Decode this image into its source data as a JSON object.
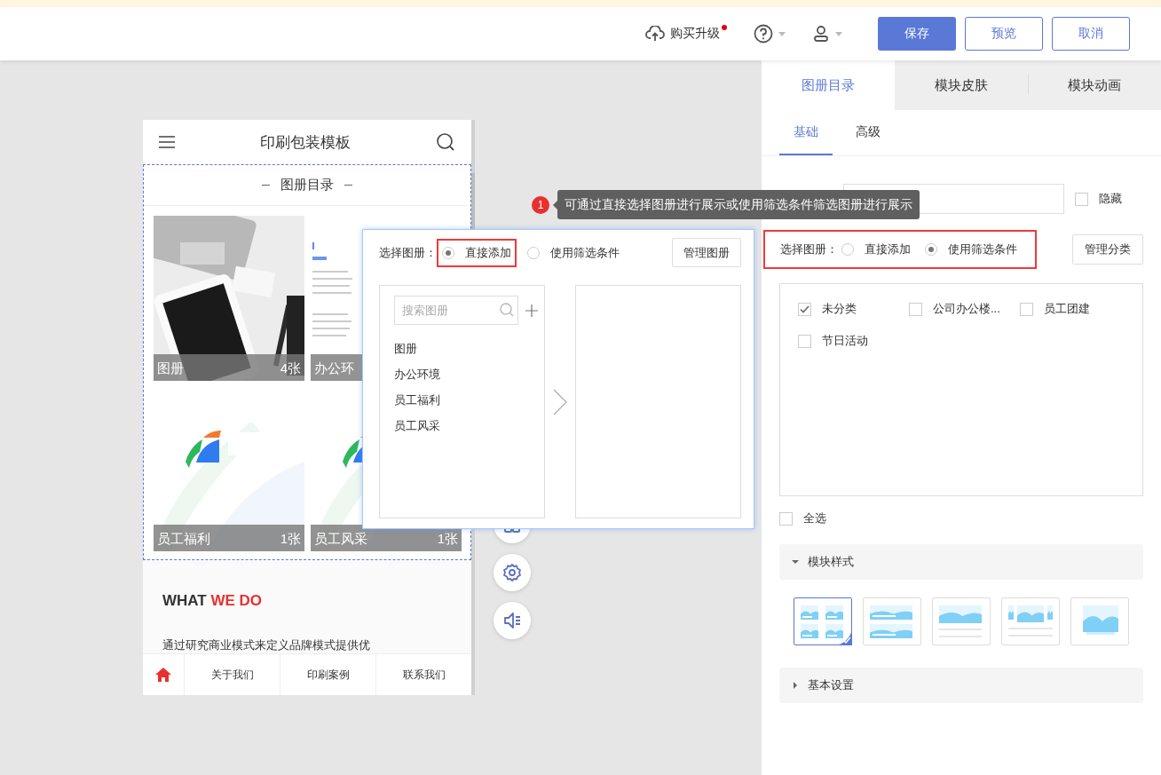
{
  "header": {
    "upgrade": {
      "label": "购买升级",
      "badge": true
    },
    "buttons": [
      {
        "label": "保存",
        "kind": "primary"
      },
      {
        "label": "预览",
        "kind": "outline"
      },
      {
        "label": "取消",
        "kind": "outline"
      }
    ]
  },
  "preview": {
    "title": "印刷包装模板",
    "module_title": "图册目录",
    "albums": [
      {
        "name": "图册",
        "count": "4张"
      },
      {
        "name": "办公环"
      },
      {
        "name": "员工福利",
        "count": "1张"
      },
      {
        "name": "员工风采",
        "count": "1张"
      }
    ],
    "intro": {
      "heading_lead": "WHAT",
      "heading_accent": "WE DO",
      "text": "通过研究商业模式来定义品牌模式提供优"
    },
    "nav": [
      "关于我们",
      "印刷案例",
      "联系我们"
    ]
  },
  "popup": {
    "label": "选择图册：",
    "modes": [
      {
        "label": "直接添加",
        "selected": true,
        "highlighted": true
      },
      {
        "label": "使用筛选条件",
        "selected": false,
        "highlighted": false
      }
    ],
    "manage_button": "管理图册",
    "search_placeholder": "搜索图册",
    "albums": [
      "图册",
      "办公环境",
      "员工福利",
      "员工风采"
    ]
  },
  "tooltip": {
    "badge": "1",
    "text": "可通过直接选择图册进行展示或使用筛选条件筛选图册进行展示"
  },
  "panel": {
    "tabs": [
      {
        "label": "图册目录",
        "selected": true
      },
      {
        "label": "模块皮肤",
        "selected": false
      },
      {
        "label": "模块动画",
        "selected": false
      }
    ],
    "subtabs": [
      {
        "label": "基础",
        "selected": true
      },
      {
        "label": "高级",
        "selected": false
      }
    ],
    "hide_option": {
      "label": "隐藏",
      "checked": false
    },
    "select": {
      "label": "选择图册：",
      "highlighted": true,
      "modes": [
        {
          "label": "直接添加",
          "selected": false
        },
        {
          "label": "使用筛选条件",
          "selected": true
        }
      ],
      "manage_button": "管理分类"
    },
    "categories": [
      {
        "label": "未分类",
        "checked": true
      },
      {
        "label": "公司办公楼...",
        "checked": false
      },
      {
        "label": "员工团建",
        "checked": false
      },
      {
        "label": "节日活动",
        "checked": false
      }
    ],
    "select_all": {
      "label": "全选",
      "checked": false
    },
    "sections": [
      {
        "title": "模块样式",
        "expanded": true,
        "styles": [
          {
            "kind": "grid",
            "selected": true
          },
          {
            "kind": "rows",
            "selected": false
          },
          {
            "kind": "card",
            "selected": false
          },
          {
            "kind": "carousel",
            "selected": false
          },
          {
            "kind": "full",
            "selected": false
          }
        ]
      },
      {
        "title": "基本设置",
        "expanded": false
      }
    ]
  }
}
